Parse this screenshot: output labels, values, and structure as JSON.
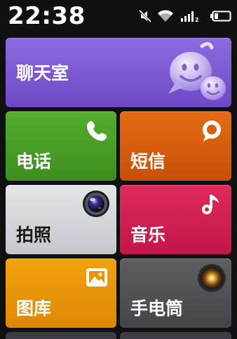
{
  "status_bar": {
    "time": "22:38",
    "icons": [
      "mute-icon",
      "wifi-icon",
      "signal-icon",
      "battery-icon"
    ],
    "signal_sim_label": "2"
  },
  "tiles": {
    "chat": {
      "label": "聊天室",
      "icon": "chat-smiley-icon",
      "color": "#7a58d2"
    },
    "phone": {
      "label": "电话",
      "icon": "phone-icon",
      "color": "#4a9f27"
    },
    "sms": {
      "label": "短信",
      "icon": "message-bubble-icon",
      "color": "#d85e0f"
    },
    "camera": {
      "label": "拍照",
      "icon": "camera-lens-icon",
      "color": "#d5d8dc"
    },
    "music": {
      "label": "音乐",
      "icon": "music-note-icon",
      "color": "#d21f52"
    },
    "gallery": {
      "label": "图库",
      "icon": "gallery-icon",
      "color": "#e99508"
    },
    "torch": {
      "label": "手电筒",
      "icon": "flashlight-icon",
      "color": "#505257"
    }
  }
}
